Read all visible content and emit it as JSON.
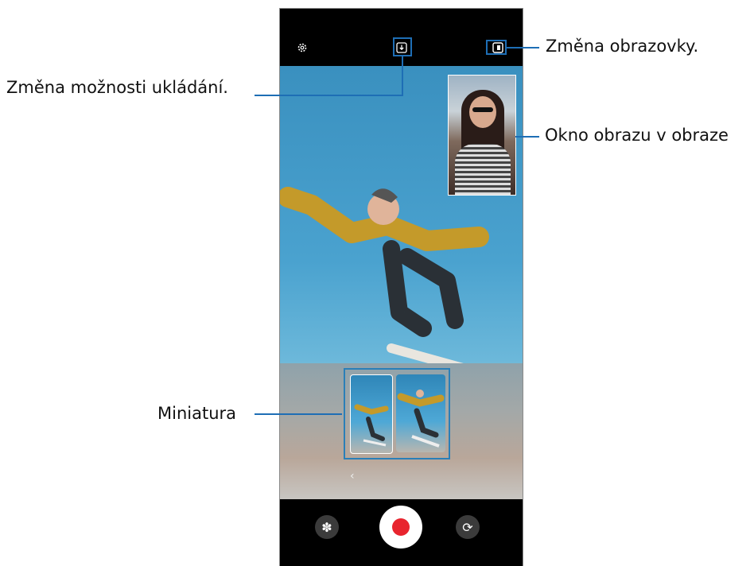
{
  "annotations": {
    "screen_switch": "Změna obrazovky.",
    "save_option": "Změna možnosti ukládání.",
    "pip_window": "Okno obrazu v obraze",
    "thumbnail": "Miniatura"
  },
  "camera": {
    "top_icons": [
      "gear-icon",
      "save-option-icon",
      "screen-switch-icon"
    ],
    "bottom_icons": [
      "effects-icon",
      "record-button",
      "switch-camera-icon"
    ],
    "collapse_glyph": "‹"
  },
  "colors": {
    "callout": "#1e6eb5",
    "record_dot": "#e8242e",
    "bar_background": "#000000"
  }
}
